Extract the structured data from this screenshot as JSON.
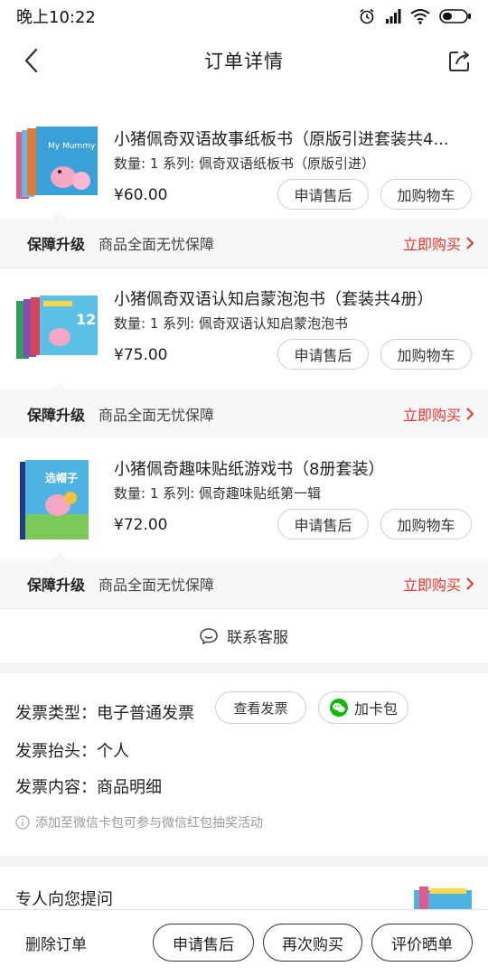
{
  "status_bar": {
    "time": "晚上10:22"
  },
  "nav": {
    "title": "订单详情"
  },
  "products": [
    {
      "title": "小猪佩奇双语故事纸板书（原版引进套装共4...",
      "meta": "数量: 1 系列: 佩奇双语纸板书（原版引进）",
      "price": "¥60.00",
      "aftersale_label": "申请售后",
      "cart_label": "加购物车",
      "cover_color": "#3aa0d8",
      "cover_text": "My Mummy"
    },
    {
      "title": "小猪佩奇双语认知启蒙泡泡书（套装共4册）",
      "meta": "数量: 1 系列: 佩奇双语认知启蒙泡泡书",
      "price": "¥75.00",
      "aftersale_label": "申请售后",
      "cart_label": "加购物车",
      "cover_color": "#5bc0e6",
      "cover_text": "12"
    },
    {
      "title": "小猪佩奇趣味贴纸游戏书（8册套装）",
      "meta": "数量: 1 系列: 佩奇趣味贴纸第一辑",
      "price": "¥72.00",
      "aftersale_label": "申请售后",
      "cart_label": "加购物车",
      "cover_color": "#4db3e3",
      "cover_text": "选帽子"
    }
  ],
  "guarantee": {
    "label": "保障升级",
    "text": "商品全面无忧保障",
    "buy": "立即购买"
  },
  "contact": {
    "label": "联系客服"
  },
  "invoice": {
    "type_label": "发票类型：",
    "type_value": "电子普通发票",
    "view_label": "查看发票",
    "card_label": "加卡包",
    "head_label": "发票抬头：",
    "head_value": "个人",
    "content_label": "发票内容：",
    "content_value": "商品明细",
    "tip": "添加至微信卡包可参与微信红包抽奖活动"
  },
  "recommend": {
    "title": "专人向您提问"
  },
  "bottom_bar": {
    "delete": "删除订单",
    "aftersale": "申请售后",
    "rebuy": "再次购买",
    "review": "评价晒单"
  },
  "colors": {
    "accent": "#e8332c",
    "wechat": "#09bb07"
  }
}
